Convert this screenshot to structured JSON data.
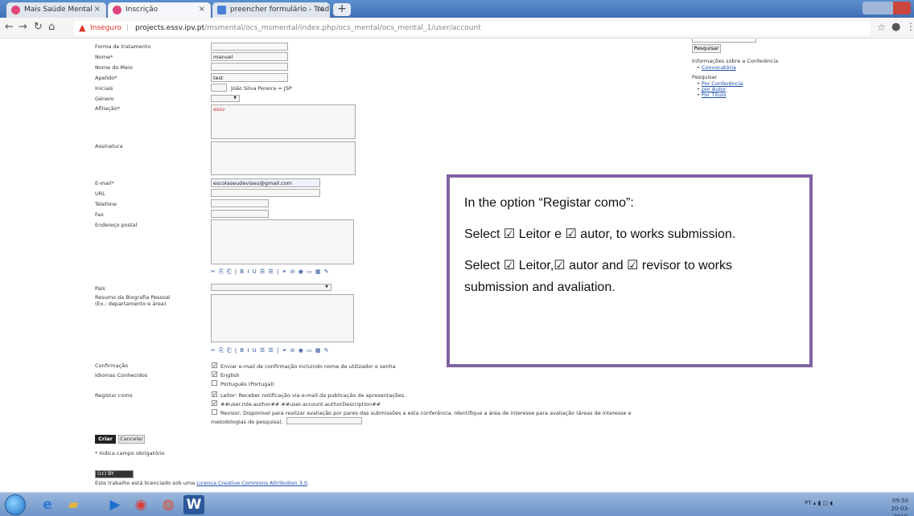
{
  "browser": {
    "tabs": [
      {
        "label": "Mais Saúde Mental",
        "close": "×"
      },
      {
        "label": "Inscrição",
        "close": "×"
      },
      {
        "label": "preencher formulário - Traduçã",
        "close": "×"
      }
    ],
    "new_tab": "+",
    "insecure_label": "Inseguro",
    "url_host": "projects.essv.ipv.pt",
    "url_path": "/msmental/ocs_msmental/index.php/ocs_mental/ocs_mental_1/user/account"
  },
  "form": {
    "fields": {
      "forma_tratamento": {
        "label": "Forma de tratamento",
        "value": ""
      },
      "nome": {
        "label": "Nome*",
        "value": "manuel"
      },
      "nome_meio": {
        "label": "Nome do Meio",
        "value": ""
      },
      "apelido": {
        "label": "Apelido*",
        "value": "test"
      },
      "iniciais": {
        "label": "Iniciais",
        "value": "",
        "hint": "João Silva Pereira = JSP"
      },
      "genero": {
        "label": "Género",
        "value": ""
      },
      "afiliacao": {
        "label": "Afiliação*",
        "value": "essv"
      },
      "assinatura": {
        "label": "Assinatura",
        "value": ""
      },
      "email": {
        "label": "E-mail*",
        "value": "escolaseudeviseu@gmail.com"
      },
      "url": {
        "label": "URL",
        "value": ""
      },
      "telefone": {
        "label": "Telefone",
        "value": ""
      },
      "fax": {
        "label": "Fax",
        "value": ""
      },
      "endereco": {
        "label": "Endereço postal",
        "value": ""
      },
      "pais": {
        "label": "País",
        "value": ""
      },
      "biografia": {
        "label_1": "Resumo da Biografia Pessoal",
        "label_2": "(Ex.: departamento e área)",
        "value": ""
      }
    },
    "rte_toolbar": "✂ ⎘ ⎗ | B I U ☰ ☰ | ⚭ ⊘ ◉ ▭ ▦ ✎",
    "confirmacao": {
      "label": "Confirmação",
      "text": "Enviar e-mail de confirmação incluindo nome de utilizador e senha",
      "checked": "✓"
    },
    "idiomas": {
      "label": "Idiomas Conhecidos",
      "options": [
        {
          "text": "English",
          "checked": "✓"
        },
        {
          "text": "Português (Portugal)",
          "checked": ""
        }
      ]
    },
    "registar": {
      "label": "Registar como",
      "options": [
        {
          "text": "Leitor: Receber notificação via e-mail da publicação de apresentações.",
          "checked": "✓"
        },
        {
          "text": "##user.role.author## ##user.account.authorDescription##",
          "checked": "✓"
        },
        {
          "text": "Revisor: Disponível para realizar avaliação por pares das submissões a esta conferência. Identifique a área de interesse para avaliação (áreas de interesse e",
          "checked": ""
        }
      ],
      "revisor_line2": "metodologias de pesquisa)."
    },
    "buttons": {
      "create": "Criar",
      "cancel": "Cancelar"
    },
    "required_note": "* Indica campo obrigatório",
    "license_prefix": "Este trabalho está licenciado sob uma ",
    "license_link": "Licença Creative Commons Attribution 3.0",
    "license_suffix": ".",
    "cc_badge": "(cc) BY"
  },
  "sidebar": {
    "search_button": "Pesquisar",
    "info_heading": "Informações sobre a Conferência",
    "info_link": "Convocatória",
    "search_heading": "Pesquisar",
    "search_links": [
      "Por Conferência",
      "por Autor",
      "Por Título"
    ]
  },
  "callout": {
    "line1": "In the option “Registar como”:",
    "line2": "Select ☑ Leitor e ☑ autor, to works submission.",
    "line3": "Select ☑ Leitor,☑ autor and ☑ revisor to works submission and avaliation."
  },
  "taskbar": {
    "tray": "PT  ▴  ▮ ◫ ◖",
    "time": "09:50",
    "date": "20-03-2019"
  },
  "colors": {
    "accent": "#8064a2",
    "link": "#1a4fb0",
    "insecure": "#d93025"
  }
}
